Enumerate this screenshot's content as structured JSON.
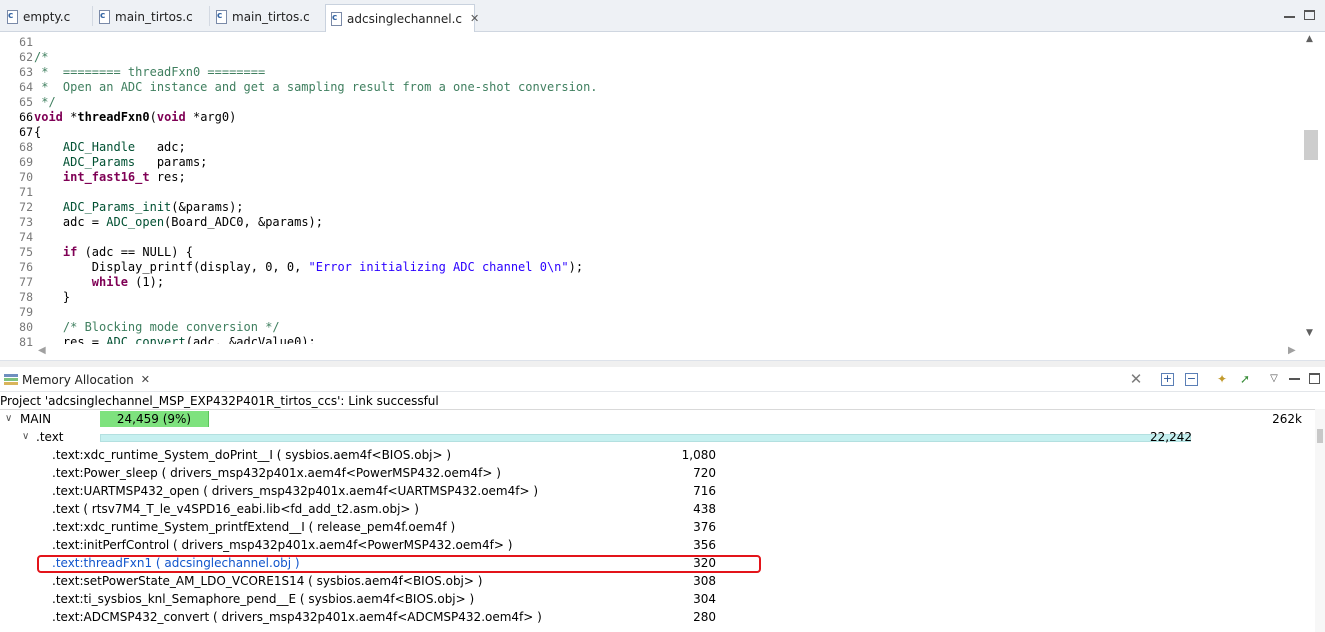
{
  "tabs": [
    {
      "name": "empty.c",
      "active": false
    },
    {
      "name": "main_tirtos.c",
      "active": false
    },
    {
      "name": "main_tirtos.c",
      "active": false
    },
    {
      "name": "adcsinglechannel.c",
      "active": true,
      "close": "✕"
    }
  ],
  "editor": {
    "lines": [
      {
        "n": "61",
        "t": ""
      },
      {
        "n": "62",
        "t": "/*"
      },
      {
        "n": "63",
        "t": " *  ======== threadFxn0 ========"
      },
      {
        "n": "64",
        "t": " *  Open an ADC instance and get a sampling result from a one-shot conversion."
      },
      {
        "n": "65",
        "t": " */"
      },
      {
        "n": "66",
        "t": "void *threadFxn0(void *arg0)"
      },
      {
        "n": "67",
        "t": "{"
      },
      {
        "n": "68",
        "t": "    ADC_Handle   adc;"
      },
      {
        "n": "69",
        "t": "    ADC_Params   params;"
      },
      {
        "n": "70",
        "t": "    int_fast16_t res;"
      },
      {
        "n": "71",
        "t": ""
      },
      {
        "n": "72",
        "t": "    ADC_Params_init(&params);"
      },
      {
        "n": "73",
        "t": "    adc = ADC_open(Board_ADC0, &params);"
      },
      {
        "n": "74",
        "t": ""
      },
      {
        "n": "75",
        "t": "    if (adc == NULL) {"
      },
      {
        "n": "76",
        "t": "        Display_printf(display, 0, 0, \"Error initializing ADC channel 0\\n\");"
      },
      {
        "n": "77",
        "t": "        while (1);"
      },
      {
        "n": "78",
        "t": "    }"
      },
      {
        "n": "79",
        "t": ""
      },
      {
        "n": "80",
        "t": "    /* Blocking mode conversion */"
      },
      {
        "n": "81",
        "t": "    res = ADC_convert(adc, &adcValue0);"
      }
    ]
  },
  "view": {
    "title": "Memory Allocation",
    "close": "✕",
    "status": "Project 'adcsinglechannel_MSP_EXP432P401R_tirtos_ccs': Link successful"
  },
  "memory": {
    "main": {
      "label": "MAIN",
      "used": "24,459 (9%)",
      "used_fraction": 0.09,
      "total": "262k"
    },
    "text": {
      "label": ".text",
      "value": "22,242",
      "fraction_of_bar": 0.909
    },
    "items": [
      {
        "label": ".text:xdc_runtime_System_doPrint__I ( sysbios.aem4f<BIOS.obj> )",
        "value": "1,080"
      },
      {
        "label": ".text:Power_sleep ( drivers_msp432p401x.aem4f<PowerMSP432.oem4f> )",
        "value": "720"
      },
      {
        "label": ".text:UARTMSP432_open ( drivers_msp432p401x.aem4f<UARTMSP432.oem4f> )",
        "value": "716"
      },
      {
        "label": ".text ( rtsv7M4_T_le_v4SPD16_eabi.lib<fd_add_t2.asm.obj> )",
        "value": "438"
      },
      {
        "label": ".text:xdc_runtime_System_printfExtend__I ( release_pem4f.oem4f )",
        "value": "376"
      },
      {
        "label": ".text:initPerfControl ( drivers_msp432p401x.aem4f<PowerMSP432.oem4f> )",
        "value": "356"
      },
      {
        "label": ".text:threadFxn1 ( adcsinglechannel.obj )",
        "value": "320",
        "highlighted": true
      },
      {
        "label": ".text:setPowerState_AM_LDO_VCORE1S14 ( sysbios.aem4f<BIOS.obj> )",
        "value": "308"
      },
      {
        "label": ".text:ti_sysbios_knl_Semaphore_pend__E ( sysbios.aem4f<BIOS.obj> )",
        "value": "304"
      },
      {
        "label": ".text:ADCMSP432_convert ( drivers_msp432p401x.aem4f<ADCMSP432.oem4f> )",
        "value": "280"
      }
    ]
  },
  "colors": {
    "main_bar": "#7ee27e",
    "text_bar": "#c6f0f0",
    "highlight_outline": "#e3141a",
    "comment": "#3f7f5f",
    "keyword": "#7f0055",
    "string": "#2a00ff"
  },
  "icons": [
    "c-file-icon",
    "close-icon",
    "memory-allocation-icon",
    "remove-icon",
    "expand-all-icon",
    "collapse-all-icon",
    "new-icon",
    "open-icon",
    "view-menu-icon",
    "minimize-icon",
    "maximize-icon"
  ]
}
